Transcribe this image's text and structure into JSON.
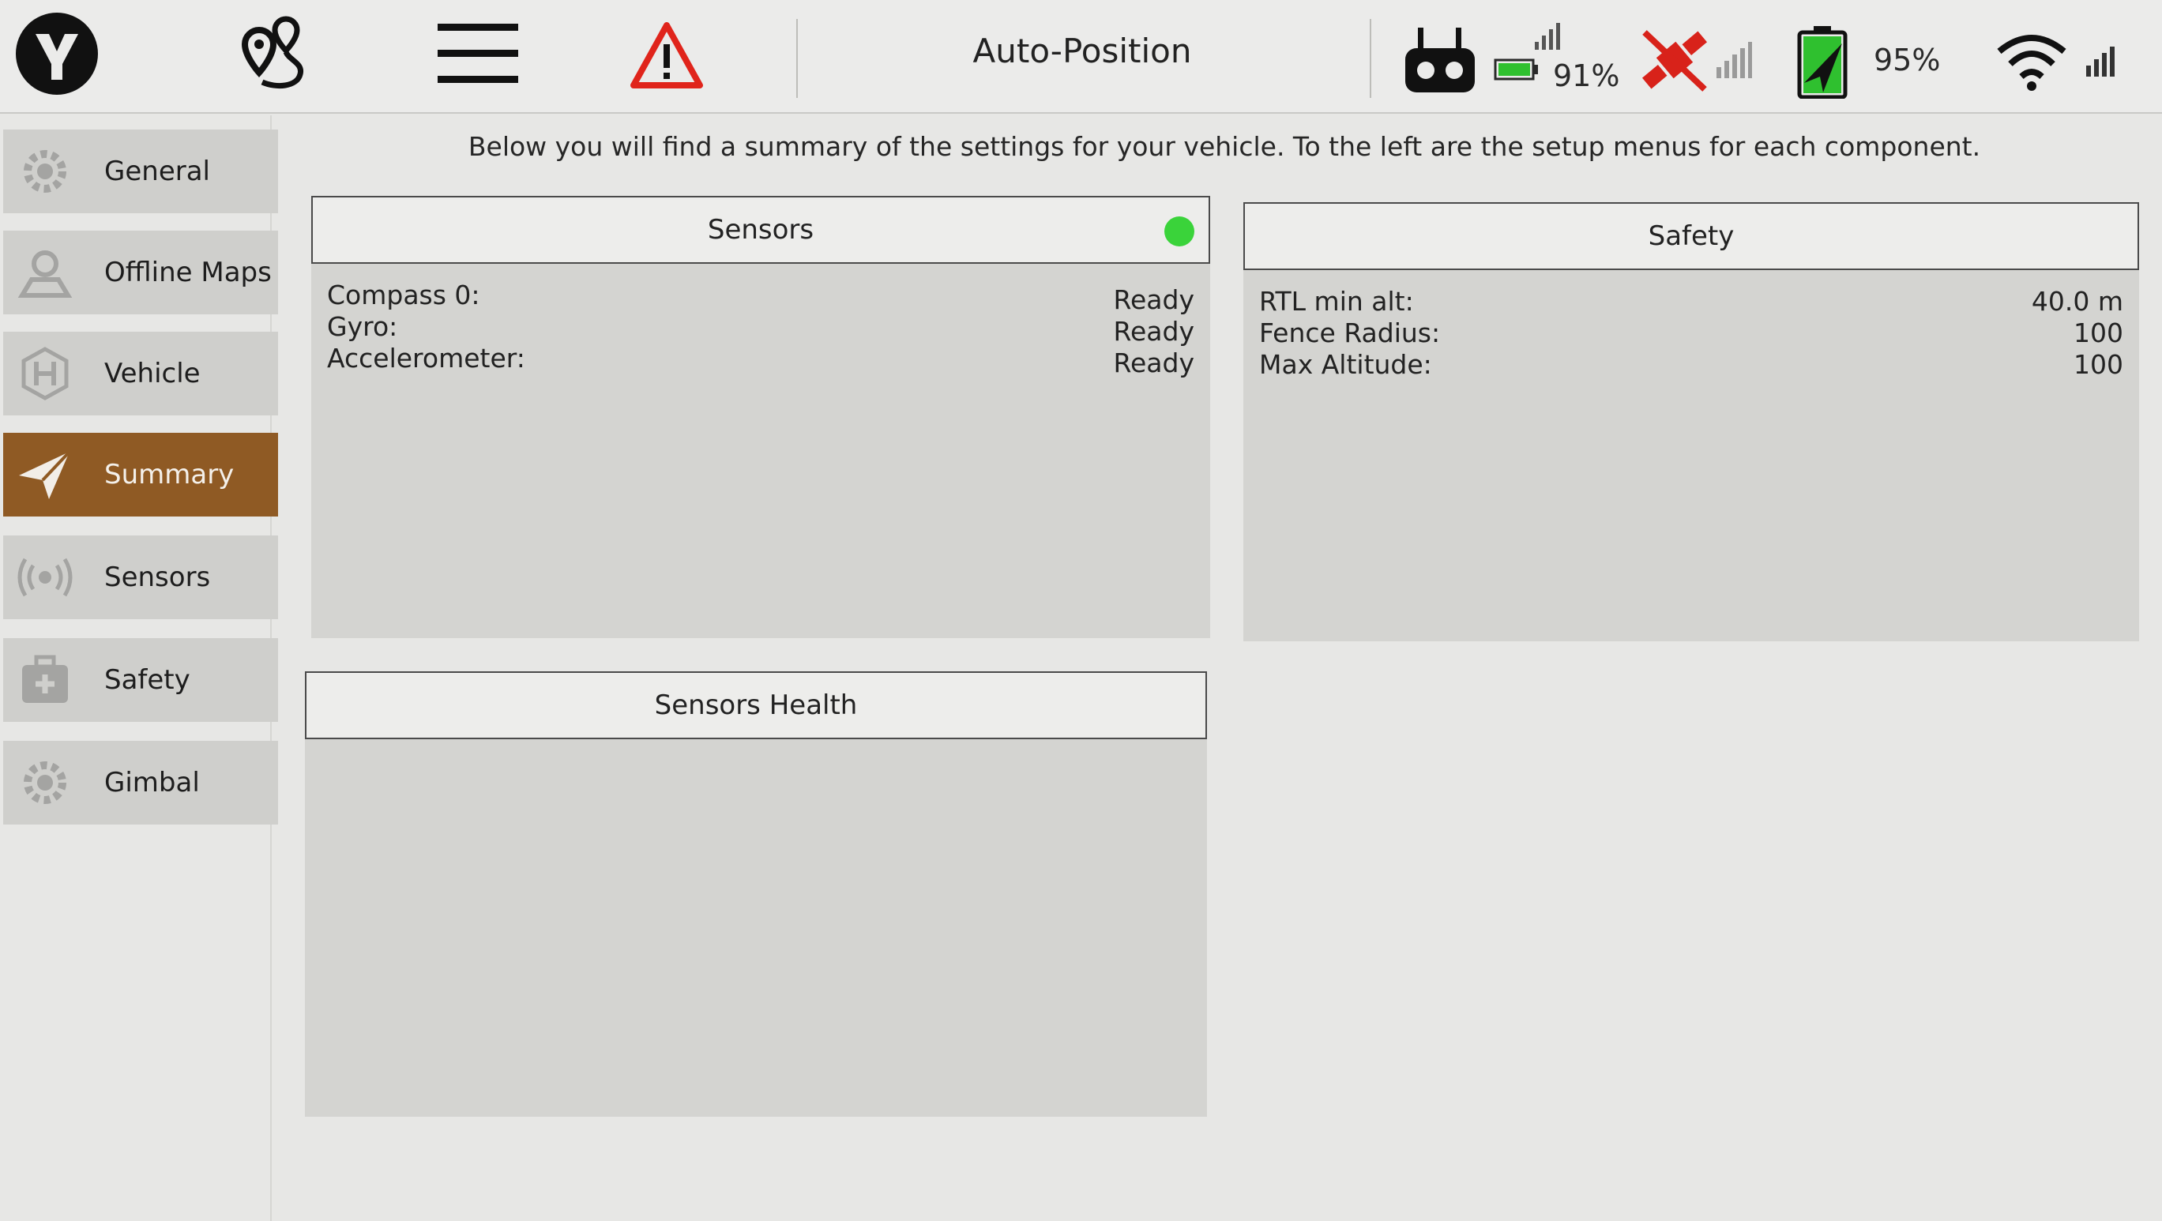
{
  "toolbar": {
    "flight_mode": "Auto-Position",
    "rc_battery": "91%",
    "vehicle_battery": "95%",
    "icons": [
      "yuneec-logo-icon",
      "plan-view-icon",
      "menu-icon",
      "warning-icon",
      "rc-controller-icon",
      "gps-off-icon",
      "battery-icon",
      "wifi-icon"
    ]
  },
  "intro": "Below you will find a summary of the settings for your vehicle. To the left are the setup menus for each component.",
  "sidebar": {
    "items": [
      {
        "label": "General",
        "icon": "gear-icon"
      },
      {
        "label": "Offline Maps",
        "icon": "map-icon"
      },
      {
        "label": "Vehicle",
        "icon": "vehicle-icon"
      },
      {
        "label": "Summary",
        "icon": "paper-plane-icon"
      },
      {
        "label": "Sensors",
        "icon": "sensor-icon"
      },
      {
        "label": "Safety",
        "icon": "safety-icon"
      },
      {
        "label": "Gimbal",
        "icon": "gear-icon"
      }
    ],
    "active": "Summary"
  },
  "sensors_panel": {
    "title": "Sensors",
    "status_color": "#3ad33a",
    "rows": [
      {
        "key": "Compass 0:",
        "value": "Ready"
      },
      {
        "key": "Gyro:",
        "value": "Ready"
      },
      {
        "key": "Accelerometer:",
        "value": "Ready"
      }
    ]
  },
  "safety_panel": {
    "title": "Safety",
    "rows": [
      {
        "key": "RTL min alt:",
        "value": "40.0 m"
      },
      {
        "key": "Fence Radius:",
        "value": "100"
      },
      {
        "key": "Max Altitude:",
        "value": "100"
      }
    ]
  },
  "sensors_health_panel": {
    "title": "Sensors Health"
  },
  "colors": {
    "accent": "#8f5a24",
    "background": "#e7e7e5",
    "panel": "#d4d4d1",
    "warning": "#e0241b",
    "battery_green": "#2fc02f"
  }
}
